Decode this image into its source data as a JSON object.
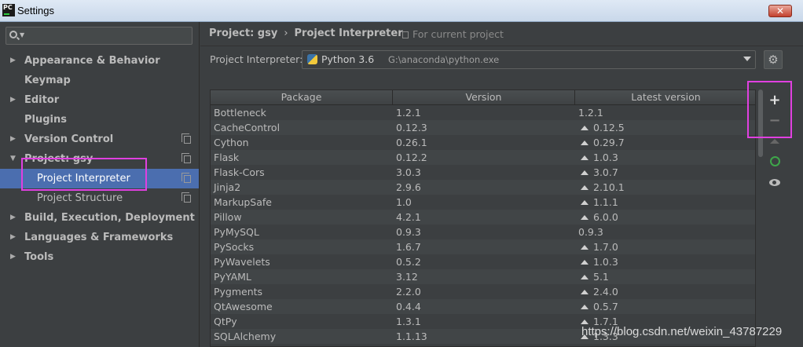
{
  "window": {
    "app_badge": "PC",
    "title": "Settings",
    "close_label": "✕"
  },
  "sidebar": {
    "search_placeholder": "",
    "items": [
      {
        "label": "Appearance & Behavior",
        "arrow": "▶"
      },
      {
        "label": "Keymap",
        "arrow": ""
      },
      {
        "label": "Editor",
        "arrow": "▶"
      },
      {
        "label": "Plugins",
        "arrow": ""
      },
      {
        "label": "Version Control",
        "arrow": "▶"
      },
      {
        "label": "Project: gsy",
        "arrow": "▼"
      },
      {
        "label": "Project Interpreter",
        "arrow": ""
      },
      {
        "label": "Project Structure",
        "arrow": ""
      },
      {
        "label": "Build, Execution, Deployment",
        "arrow": "▶"
      },
      {
        "label": "Languages & Frameworks",
        "arrow": "▶"
      },
      {
        "label": "Tools",
        "arrow": "▶"
      }
    ]
  },
  "breadcrumb": {
    "project": "Project: gsy",
    "separator": "›",
    "page": "Project Interpreter",
    "scope": "For current project"
  },
  "interpreter": {
    "label": "Project Interpreter:",
    "name": "Python 3.6",
    "path": "G:\\anaconda\\python.exe"
  },
  "table": {
    "columns": [
      "Package",
      "Version",
      "Latest version"
    ],
    "rows": [
      {
        "package": "Bottleneck",
        "version": "1.2.1",
        "latest": "1.2.1"
      },
      {
        "package": "CacheControl",
        "version": "0.12.3",
        "latest": "0.12.5"
      },
      {
        "package": "Cython",
        "version": "0.26.1",
        "latest": "0.29.7"
      },
      {
        "package": "Flask",
        "version": "0.12.2",
        "latest": "1.0.3"
      },
      {
        "package": "Flask-Cors",
        "version": "3.0.3",
        "latest": "3.0.7"
      },
      {
        "package": "Jinja2",
        "version": "2.9.6",
        "latest": "2.10.1"
      },
      {
        "package": "MarkupSafe",
        "version": "1.0",
        "latest": "1.1.1"
      },
      {
        "package": "Pillow",
        "version": "4.2.1",
        "latest": "6.0.0"
      },
      {
        "package": "PyMySQL",
        "version": "0.9.3",
        "latest": "0.9.3"
      },
      {
        "package": "PySocks",
        "version": "1.6.7",
        "latest": "1.7.0"
      },
      {
        "package": "PyWavelets",
        "version": "0.5.2",
        "latest": "1.0.3"
      },
      {
        "package": "PyYAML",
        "version": "3.12",
        "latest": "5.1"
      },
      {
        "package": "Pygments",
        "version": "2.2.0",
        "latest": "2.4.0"
      },
      {
        "package": "QtAwesome",
        "version": "0.4.4",
        "latest": "0.5.7"
      },
      {
        "package": "QtPy",
        "version": "1.3.1",
        "latest": "1.7.1"
      },
      {
        "package": "SQLAlchemy",
        "version": "1.1.13",
        "latest": "1.3.3"
      }
    ]
  },
  "toolbar": {
    "add": "+",
    "remove": "−",
    "gear": "⚙"
  },
  "watermark": "https://blog.csdn.net/weixin_43787229",
  "colors": {
    "background": "#3c3f41",
    "selection": "#4b6eaf",
    "highlight": "#e040e0",
    "refresh": "#3ea64a"
  }
}
